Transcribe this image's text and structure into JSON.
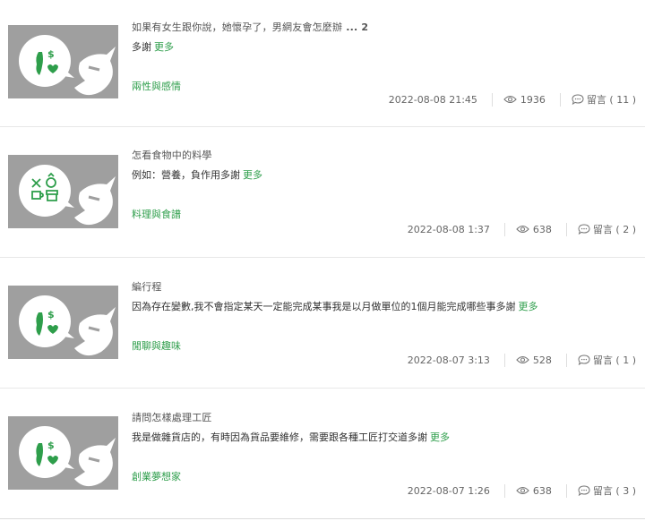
{
  "more_label": "更多",
  "posts": [
    {
      "title": "如果有女生跟你說，她懷孕了，男網友會怎麼辦",
      "ellipsis": "...",
      "page_count": "2",
      "excerpt": "多謝",
      "category": "兩性與感情",
      "date": "2022-08-08 21:45",
      "views": "1936",
      "comments": "留言 ( 11 )",
      "thumb_icon": "taiwan-money-heart"
    },
    {
      "title": "怎看食物中的料學",
      "excerpt": "例如：營養，負作用多謝",
      "category": "料理與食譜",
      "date": "2022-08-08 1:37",
      "views": "638",
      "comments": "留言 ( 2 )",
      "thumb_icon": "cooking-utensils"
    },
    {
      "title": "編行程",
      "excerpt": "因為存在變數,我不會指定某天一定能完成某事我是以月做單位的1個月能完成哪些事多謝",
      "category": "閒聊與趣味",
      "date": "2022-08-07 3:13",
      "views": "528",
      "comments": "留言 ( 1 )",
      "thumb_icon": "taiwan-money-heart"
    },
    {
      "title": "請問怎樣處理工匠",
      "excerpt": "我是做雜貨店的，有時因為貨品要維修，需要跟各種工匠打交道多謝",
      "category": "創業夢想家",
      "date": "2022-08-07 1:26",
      "views": "638",
      "comments": "留言 ( 3 )",
      "thumb_icon": "taiwan-money-heart"
    }
  ],
  "colors": {
    "accent": "#2e9e4b",
    "thumb_bg": "#9f9f9f"
  }
}
